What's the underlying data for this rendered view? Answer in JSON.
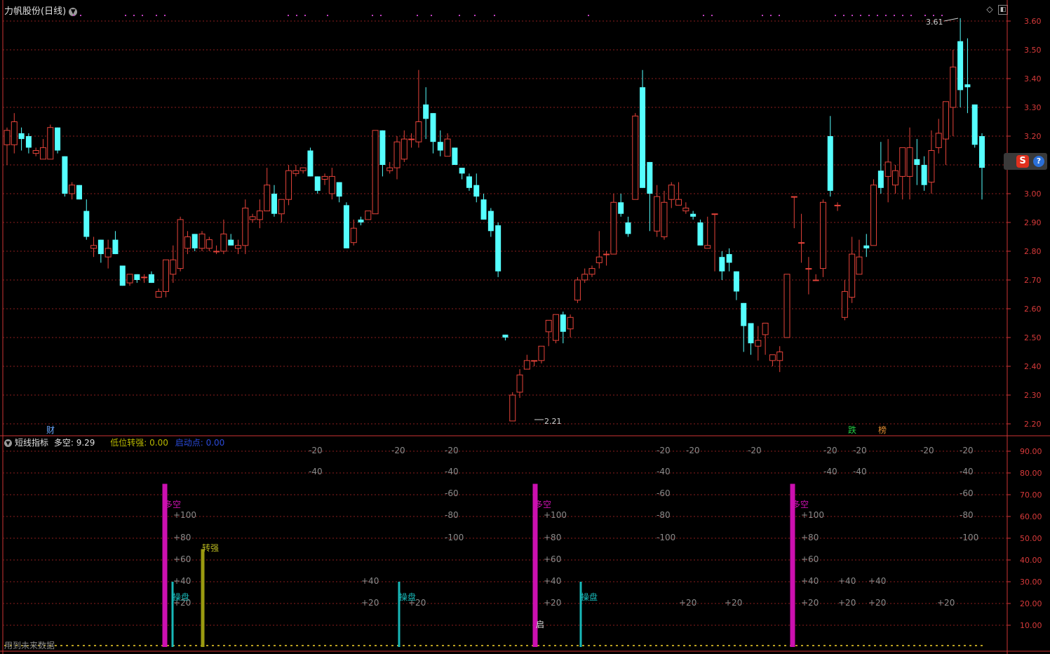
{
  "window": {
    "stock_title": "力帆股份",
    "period": "(日线)",
    "collapse_icon": "chevron-down-icon"
  },
  "main_chart": {
    "price_axis_ticks": [
      "3.60",
      "3.50",
      "3.40",
      "3.30",
      "3.20",
      "3.10",
      "3.00",
      "2.90",
      "2.80",
      "2.70",
      "2.60",
      "2.50",
      "2.40",
      "2.30",
      "2.20"
    ],
    "high_label": "3.61",
    "low_label": "2.21",
    "markers": {
      "cai": "财",
      "die": "跌",
      "bang": "榜"
    },
    "colors": {
      "up": "#e5433a",
      "down": "#55ffff",
      "grid": "#8b1e1e",
      "axis": "#cc3333"
    }
  },
  "indicator": {
    "name": "短线指标",
    "duokong_label": "多空:",
    "duokong_value": "9.29",
    "diwei_label": "低位转强:",
    "diwei_value": "0.00",
    "qidong_label": "启动点:",
    "qidong_value": "0.00",
    "axis_ticks": [
      "90.00",
      "80.00",
      "70.00",
      "60.00",
      "50.00",
      "40.00",
      "30.00",
      "20.00",
      "10.00"
    ],
    "bar_labels": {
      "duokong": "多空",
      "caopan": "操盘",
      "zhuanqiang": "转强",
      "qi": "启"
    },
    "warning": "用到未来数据",
    "colors": {
      "magenta": "#cc10b0",
      "teal": "#18b8b8",
      "olive": "#9a9a10",
      "diwei": "#c8c800",
      "qidong": "#2a4ad8"
    }
  },
  "chart_data": {
    "type": "candlestick",
    "title": "力帆股份 (日线)",
    "ylabel": "",
    "ylim": [
      2.18,
      3.63
    ],
    "y_ticks": [
      2.2,
      2.3,
      2.4,
      2.5,
      2.6,
      2.7,
      2.8,
      2.9,
      3.0,
      3.1,
      3.2,
      3.3,
      3.4,
      3.5,
      3.6
    ],
    "series": [
      {
        "name": "K",
        "ohlc": [
          [
            3.17,
            3.22,
            3.1,
            3.23
          ],
          [
            3.17,
            3.25,
            3.14,
            3.28
          ],
          [
            3.21,
            3.19,
            3.15,
            3.23
          ],
          [
            3.2,
            3.16,
            3.14,
            3.21
          ],
          [
            3.14,
            3.15,
            3.13,
            3.16
          ],
          [
            3.12,
            3.16,
            3.12,
            3.19
          ],
          [
            3.12,
            3.23,
            3.12,
            3.24
          ],
          [
            3.23,
            3.15,
            3.14,
            3.23
          ],
          [
            3.13,
            3.0,
            2.99,
            3.13
          ],
          [
            3.0,
            3.03,
            2.98,
            3.04
          ],
          [
            3.03,
            2.98,
            2.98,
            3.03
          ],
          [
            2.94,
            2.85,
            2.84,
            2.98
          ],
          [
            2.81,
            2.82,
            2.78,
            2.85
          ],
          [
            2.84,
            2.79,
            2.76,
            2.84
          ],
          [
            2.78,
            2.81,
            2.74,
            2.84
          ],
          [
            2.84,
            2.79,
            2.79,
            2.87
          ],
          [
            2.75,
            2.68,
            2.68,
            2.75
          ],
          [
            2.69,
            2.72,
            2.68,
            2.72
          ],
          [
            2.72,
            2.7,
            2.69,
            2.72
          ],
          [
            2.71,
            2.71,
            2.69,
            2.72
          ],
          [
            2.72,
            2.69,
            2.69,
            2.73
          ],
          [
            2.64,
            2.66,
            2.64,
            2.67
          ],
          [
            2.66,
            2.77,
            2.64,
            2.77
          ],
          [
            2.72,
            2.77,
            2.69,
            2.82
          ],
          [
            2.74,
            2.91,
            2.73,
            2.92
          ],
          [
            2.81,
            2.85,
            2.79,
            2.87
          ],
          [
            2.86,
            2.81,
            2.8,
            2.86
          ],
          [
            2.81,
            2.86,
            2.8,
            2.87
          ],
          [
            2.81,
            2.84,
            2.8,
            2.85
          ],
          [
            2.8,
            2.8,
            2.79,
            2.82
          ],
          [
            2.8,
            2.86,
            2.79,
            2.91
          ],
          [
            2.84,
            2.82,
            2.82,
            2.86
          ],
          [
            2.81,
            2.82,
            2.79,
            2.84
          ],
          [
            2.82,
            2.95,
            2.79,
            2.98
          ],
          [
            2.91,
            2.92,
            2.9,
            2.93
          ],
          [
            2.91,
            2.94,
            2.88,
            2.98
          ],
          [
            2.94,
            3.03,
            2.94,
            3.09
          ],
          [
            3.0,
            2.93,
            2.92,
            3.03
          ],
          [
            2.93,
            2.98,
            2.9,
            2.98
          ],
          [
            2.98,
            3.08,
            2.96,
            3.1
          ],
          [
            3.07,
            3.08,
            3.06,
            3.1
          ],
          [
            3.08,
            3.09,
            3.07,
            3.09
          ],
          [
            3.15,
            3.06,
            3.06,
            3.16
          ],
          [
            3.06,
            3.01,
            3.0,
            3.06
          ],
          [
            3.05,
            3.06,
            3.03,
            3.07
          ],
          [
            3.0,
            3.06,
            2.98,
            3.09
          ],
          [
            3.04,
            2.99,
            2.97,
            3.04
          ],
          [
            2.96,
            2.81,
            2.81,
            2.97
          ],
          [
            2.83,
            2.88,
            2.82,
            2.91
          ],
          [
            2.91,
            2.9,
            2.89,
            2.92
          ],
          [
            2.91,
            2.94,
            2.91,
            2.94
          ],
          [
            2.93,
            3.22,
            2.93,
            3.22
          ],
          [
            3.22,
            3.1,
            3.06,
            3.22
          ],
          [
            3.08,
            3.09,
            3.07,
            3.11
          ],
          [
            3.09,
            3.18,
            3.05,
            3.2
          ],
          [
            3.12,
            3.19,
            3.11,
            3.22
          ],
          [
            3.19,
            3.19,
            3.16,
            3.21
          ],
          [
            3.18,
            3.25,
            3.16,
            3.43
          ],
          [
            3.31,
            3.26,
            3.19,
            3.37
          ],
          [
            3.28,
            3.18,
            3.14,
            3.28
          ],
          [
            3.18,
            3.15,
            3.13,
            3.22
          ],
          [
            3.13,
            3.19,
            3.14,
            3.21
          ],
          [
            3.16,
            3.1,
            3.1,
            3.16
          ],
          [
            3.09,
            3.07,
            3.05,
            3.09
          ],
          [
            3.06,
            3.02,
            3.01,
            3.07
          ],
          [
            3.03,
            2.99,
            2.97,
            3.07
          ],
          [
            2.98,
            2.91,
            2.91,
            3.0
          ],
          [
            2.94,
            2.87,
            2.85,
            2.95
          ],
          [
            2.89,
            2.73,
            2.71,
            2.9
          ],
          [
            2.51,
            2.5,
            2.49,
            2.51
          ],
          [
            2.21,
            2.3,
            2.21,
            2.31
          ],
          [
            2.31,
            2.37,
            2.29,
            2.39
          ],
          [
            2.39,
            2.42,
            2.4,
            2.44
          ],
          [
            2.42,
            2.42,
            2.4,
            2.42
          ],
          [
            2.42,
            2.47,
            2.41,
            2.47
          ],
          [
            2.52,
            2.56,
            2.47,
            2.56
          ],
          [
            2.49,
            2.58,
            2.48,
            2.58
          ],
          [
            2.58,
            2.52,
            2.48,
            2.59
          ],
          [
            2.53,
            2.57,
            2.5,
            2.58
          ],
          [
            2.63,
            2.7,
            2.62,
            2.71
          ],
          [
            2.7,
            2.72,
            2.69,
            2.74
          ],
          [
            2.72,
            2.74,
            2.71,
            2.75
          ],
          [
            2.76,
            2.78,
            2.74,
            2.87
          ],
          [
            2.79,
            2.79,
            2.75,
            2.8
          ],
          [
            2.79,
            2.97,
            2.79,
            3.0
          ],
          [
            2.97,
            2.93,
            2.92,
            3.0
          ],
          [
            2.9,
            2.86,
            2.85,
            2.92
          ],
          [
            2.98,
            3.27,
            2.98,
            3.28
          ],
          [
            3.37,
            3.02,
            3.02,
            3.43
          ],
          [
            3.11,
            3.0,
            2.87,
            3.11
          ],
          [
            2.87,
            2.99,
            2.85,
            3.03
          ],
          [
            2.85,
            2.97,
            2.84,
            3.01
          ],
          [
            2.98,
            3.03,
            2.95,
            3.04
          ],
          [
            2.96,
            2.98,
            2.96,
            3.04
          ],
          [
            2.94,
            2.95,
            2.93,
            2.97
          ],
          [
            2.93,
            2.92,
            2.91,
            2.94
          ],
          [
            2.9,
            2.82,
            2.82,
            2.91
          ],
          [
            2.81,
            2.82,
            2.81,
            2.92
          ],
          [
            2.93,
            2.93,
            2.73,
            2.93
          ],
          [
            2.78,
            2.73,
            2.7,
            2.8
          ],
          [
            2.79,
            2.76,
            2.73,
            2.81
          ],
          [
            2.73,
            2.66,
            2.63,
            2.73
          ],
          [
            2.62,
            2.54,
            2.45,
            2.62
          ],
          [
            2.55,
            2.48,
            2.44,
            2.55
          ],
          [
            2.47,
            2.49,
            2.42,
            2.54
          ],
          [
            2.51,
            2.55,
            2.44,
            2.55
          ],
          [
            2.42,
            2.44,
            2.4,
            2.44
          ],
          [
            2.42,
            2.45,
            2.38,
            2.47
          ],
          [
            2.5,
            2.72,
            2.5,
            2.72
          ],
          [
            2.99,
            2.99,
            2.88,
            2.99
          ],
          [
            2.83,
            2.83,
            2.76,
            2.93
          ],
          [
            2.74,
            2.74,
            2.65,
            2.78
          ],
          [
            2.7,
            2.7,
            2.7,
            2.72
          ],
          [
            2.74,
            2.97,
            2.71,
            2.98
          ],
          [
            3.2,
            3.01,
            2.99,
            3.27
          ],
          [
            2.96,
            2.96,
            2.94,
            2.97
          ],
          [
            2.57,
            2.66,
            2.56,
            2.7
          ],
          [
            2.64,
            2.79,
            2.62,
            2.85
          ],
          [
            2.72,
            2.78,
            2.72,
            2.84
          ],
          [
            2.82,
            2.81,
            2.78,
            2.86
          ],
          [
            2.82,
            3.03,
            2.82,
            3.05
          ],
          [
            3.08,
            3.02,
            3.0,
            3.18
          ],
          [
            3.06,
            3.11,
            2.97,
            3.19
          ],
          [
            3.03,
            3.08,
            3.0,
            3.1
          ],
          [
            3.06,
            3.16,
            2.98,
            3.15
          ],
          [
            3.06,
            3.16,
            2.98,
            3.23
          ],
          [
            3.12,
            3.1,
            3.03,
            3.19
          ],
          [
            3.1,
            3.03,
            3.01,
            3.13
          ],
          [
            3.04,
            3.15,
            3.0,
            3.22
          ],
          [
            3.16,
            3.21,
            3.14,
            3.26
          ],
          [
            3.19,
            3.32,
            3.1,
            3.24
          ],
          [
            3.3,
            3.44,
            3.2,
            3.5
          ],
          [
            3.53,
            3.36,
            3.3,
            3.61
          ],
          [
            3.38,
            3.37,
            3.28,
            3.54
          ],
          [
            3.31,
            3.17,
            3.16,
            3.31
          ],
          [
            3.2,
            3.09,
            2.98,
            3.21
          ]
        ]
      }
    ],
    "annotations": {
      "high": "3.61",
      "low": "2.21"
    }
  }
}
